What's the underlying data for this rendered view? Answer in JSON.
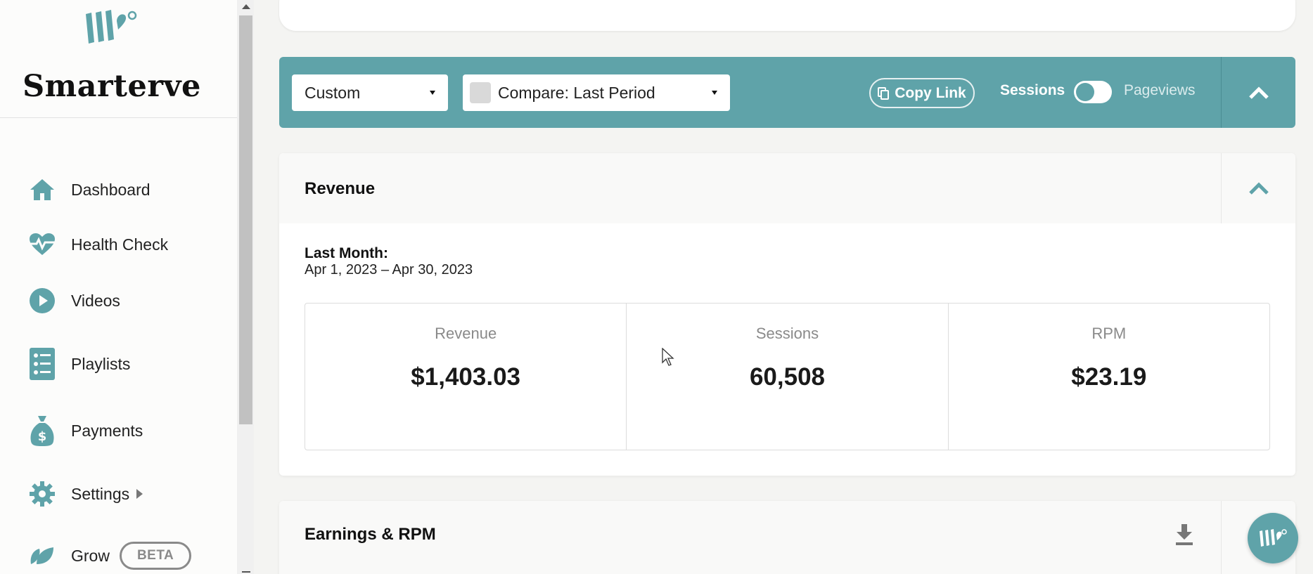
{
  "sidebar": {
    "brand": "Smarterve",
    "items": [
      {
        "label": "Dashboard",
        "icon": "home-icon"
      },
      {
        "label": "Health Check",
        "icon": "heart-pulse-icon"
      },
      {
        "label": "Videos",
        "icon": "play-circle-icon"
      },
      {
        "label": "Playlists",
        "icon": "checklist-icon"
      },
      {
        "label": "Payments",
        "icon": "money-bag-icon"
      },
      {
        "label": "Settings",
        "icon": "gear-icon"
      },
      {
        "label": "Grow",
        "icon": "leaf-icon",
        "badge": "BETA"
      }
    ]
  },
  "toolbar": {
    "date_range": "Custom",
    "compare": "Compare: Last Period",
    "copy_link": "Copy Link",
    "toggle_left": "Sessions",
    "toggle_right": "Pageviews"
  },
  "revenue": {
    "title": "Revenue",
    "period_label": "Last Month:",
    "period_range": "Apr 1, 2023 – Apr 30, 2023",
    "stats": [
      {
        "label": "Revenue",
        "value": "$1,403.03"
      },
      {
        "label": "Sessions",
        "value": "60,508"
      },
      {
        "label": "RPM",
        "value": "$23.19"
      }
    ]
  },
  "earnings": {
    "title": "Earnings & RPM"
  },
  "colors": {
    "accent": "#5fa3a9",
    "background": "#f4f4f2"
  }
}
